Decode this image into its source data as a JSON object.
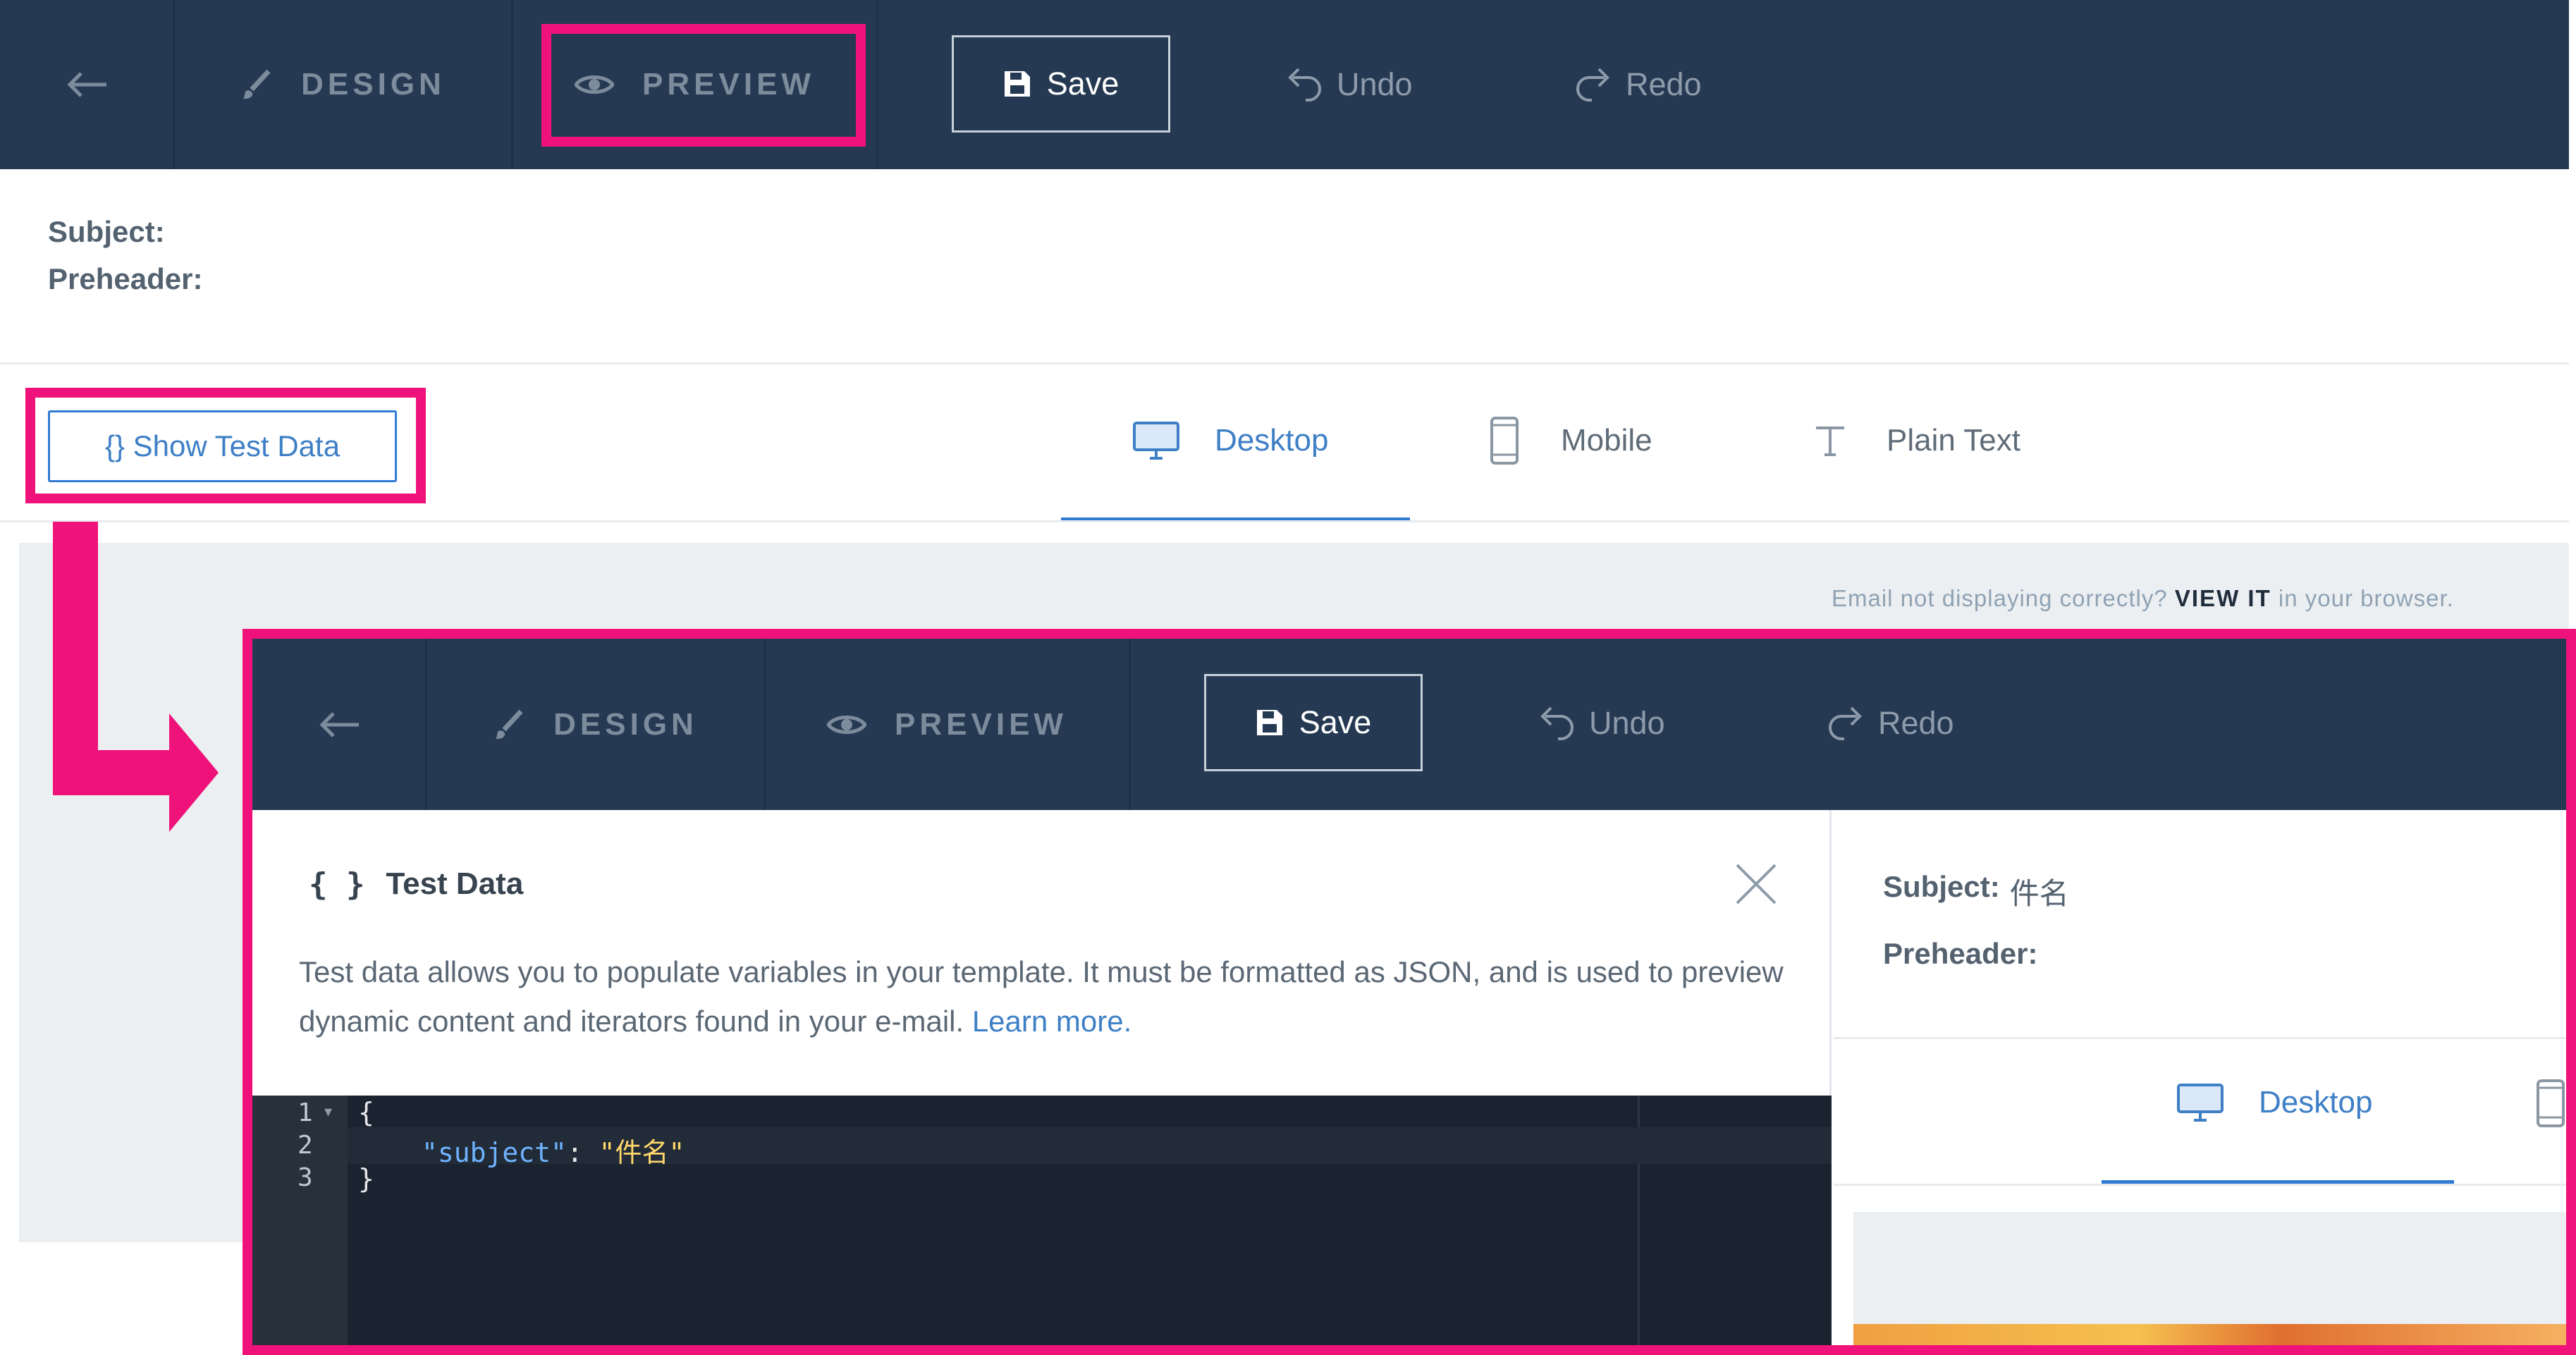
{
  "toolbar": {
    "design_label": "DESIGN",
    "preview_label": "PREVIEW",
    "save_label": "Save",
    "undo_label": "Undo",
    "redo_label": "Redo"
  },
  "header": {
    "subject_label": "Subject:",
    "preheader_label": "Preheader:"
  },
  "show_test_data_label": "{} Show Test Data",
  "tabs": [
    {
      "label": "Desktop",
      "active": true
    },
    {
      "label": "Mobile",
      "active": false
    },
    {
      "label": "Plain Text",
      "active": false
    }
  ],
  "browser_note": {
    "prefix": "Email not displaying correctly?",
    "link": "VIEW IT",
    "suffix": "in your browser."
  },
  "test_panel": {
    "icon_text": "{ }",
    "title": "Test Data",
    "description": "Test data allows you to populate variables in your template. It must be formatted as JSON, and is used to preview dynamic content and iterators found in your e-mail.",
    "learn_more": "Learn more."
  },
  "code": {
    "line_numbers": [
      "1",
      "2",
      "3"
    ],
    "open_brace": "{",
    "key": "\"subject\"",
    "colon": ": ",
    "value": "\"件名\"",
    "close_brace": "}"
  },
  "inset_header": {
    "subject_label": "Subject:",
    "subject_value": "件名",
    "preheader_label": "Preheader:",
    "desktop_tab": "Desktop"
  },
  "colors": {
    "toolbar_bg": "#253a52",
    "highlight": "#f0127b",
    "accent": "#2f7bd3"
  }
}
